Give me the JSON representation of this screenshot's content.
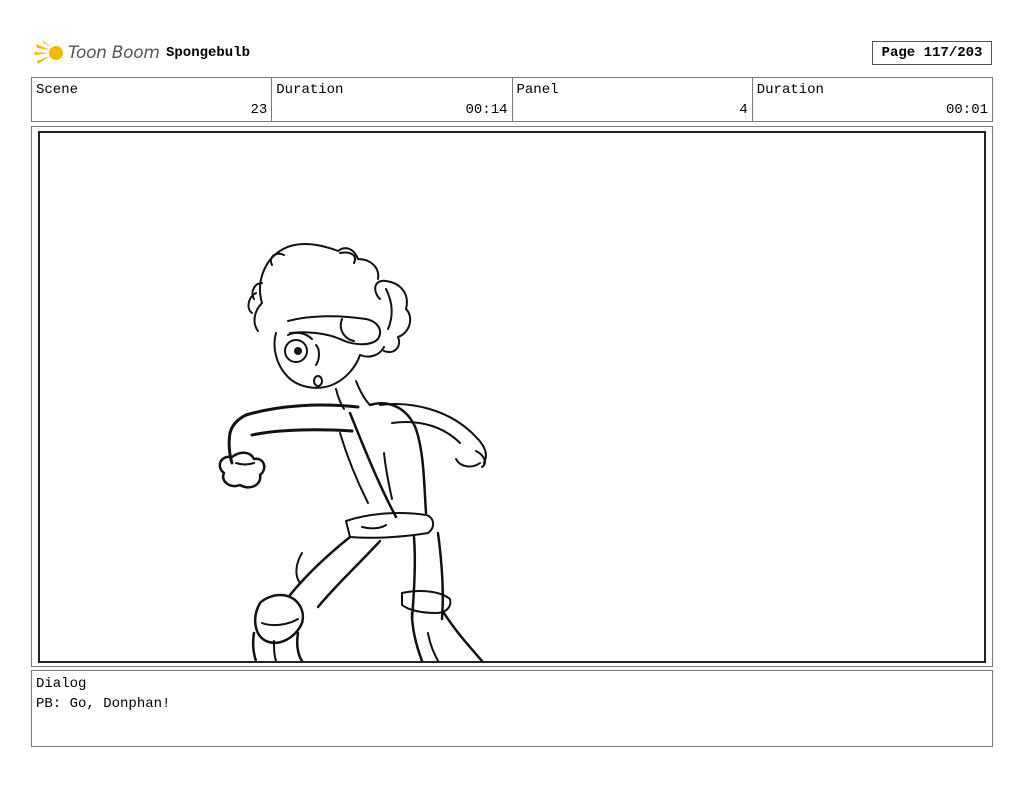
{
  "header": {
    "brand": "Toon Boom",
    "project": "Spongebulb",
    "page": "Page 117/203"
  },
  "info": {
    "scene_label": "Scene",
    "scene_value": "23",
    "scene_duration_label": "Duration",
    "scene_duration_value": "00:14",
    "panel_label": "Panel",
    "panel_value": "4",
    "panel_duration_label": "Duration",
    "panel_duration_value": "00:01"
  },
  "panel": {
    "image_icon": "storyboard-sketch"
  },
  "dialog": {
    "label": "Dialog",
    "text": "PB: Go, Donphan!"
  },
  "colors": {
    "brand_yellow": "#f5b800",
    "brand_text": "#555555",
    "border": "#777777"
  }
}
